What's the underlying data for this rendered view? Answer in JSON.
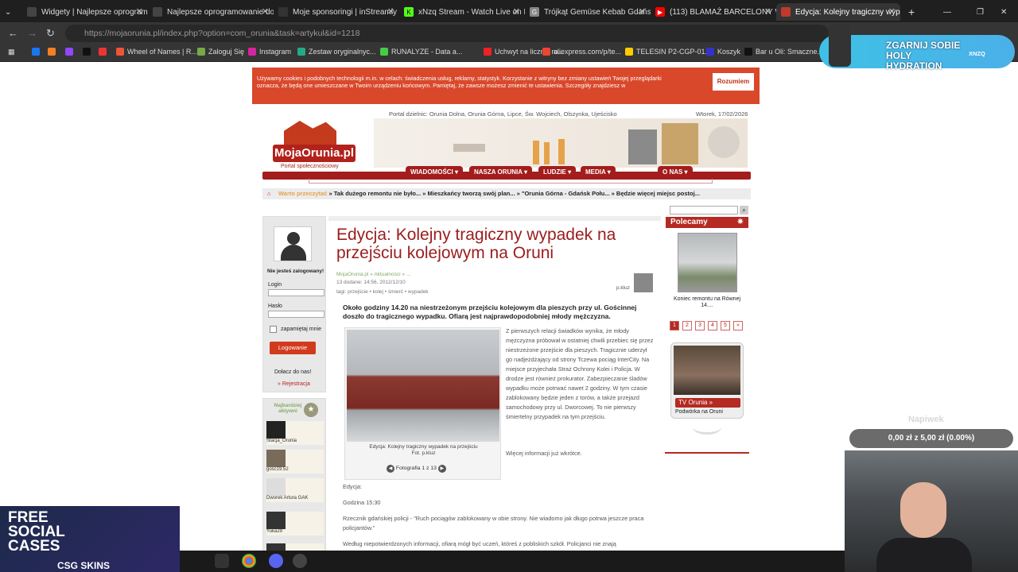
{
  "browser": {
    "tabs": [
      {
        "label": "Widgety | Najlepsze oprogramo",
        "color": "#444"
      },
      {
        "label": "Najlepsze oprogramowanie do",
        "color": "#444"
      },
      {
        "label": "Moje sponsoringi | inStreamly",
        "color": "#333"
      },
      {
        "label": "xNzq Stream - Watch Live on K",
        "color": "#53fc18"
      },
      {
        "label": "Trójkąt Gemüse Kebab Gdańsk",
        "color": "#888"
      },
      {
        "label": "(113) BLAMAŻ BARCELONY W",
        "color": "#ff0000"
      },
      {
        "label": "Edycja: Kolejny tragiczny wypa",
        "color": "#c0392b"
      }
    ],
    "url": "https://mojaorunia.pl/index.php?option=com_orunia&task=artykul&id=1218",
    "bookmarks": [
      {
        "label": "",
        "color": "#1877f2"
      },
      {
        "label": "",
        "color": "#f48024"
      },
      {
        "label": "",
        "color": "#9146ff"
      },
      {
        "label": "",
        "color": "#111"
      },
      {
        "label": "",
        "color": "#e33"
      },
      {
        "label": "Wheel of Names | R...",
        "color": "#e53"
      },
      {
        "label": "Zaloguj Się",
        "color": "#7a4"
      },
      {
        "label": "Instagram",
        "color": "#d6249f"
      },
      {
        "label": "Zestaw oryginalnyc...",
        "color": "#2a8"
      },
      {
        "label": "RUNALYZE - Data a...",
        "color": "#4c4"
      },
      {
        "label": "Uchwyt na licznik ro...",
        "color": "#e22"
      },
      {
        "label": "aliexpress.com/p/te...",
        "color": "#e43"
      },
      {
        "label": "TELESIN P2-CGP-01...",
        "color": "#fc0"
      },
      {
        "label": "Koszyk",
        "color": "#33c"
      },
      {
        "label": "Bar u Oli: Smaczne...",
        "color": "#111"
      }
    ]
  },
  "cookie": {
    "text": "Używamy cookies i podobnych technologii m.in. w celach: świadczenia usług, reklamy, statystyk. Korzystanie z witryny bez zmiany ustawień Twojej przeglądarki oznacza, że będą one umieszczane w Twoim urządzeniu końcowym. Pamiętaj, że zawsze możesz zmienić te ustawienia. Szczegóły znajdziesz w",
    "button": "Rozumiem"
  },
  "header": {
    "portal": "Portal dzielnic: Orunia Dolna, Orunia Górna, Lipce, Św. Wojciech, Olszynka, Ujeścisko",
    "date": "Wtorek, 17/02/2026",
    "logo": "MojaOrunia.pl",
    "logo_sub": "Portal społecznościowy",
    "menu": [
      "WIADOMOŚCI ▾",
      "NASZA ORUNIA ▾",
      "LUDZIE ▾",
      "MEDIA ▾",
      "O NAS ▾"
    ],
    "news_prefix": "Warto przeczytać",
    "news": "» Tak dużego remontu nie było... » Mieszkańcy tworzą swój plan... » \"Orunia Górna - Gdańsk Połu... » Będzie więcej miejsc postoj..."
  },
  "login": {
    "status": "Nie jesteś zalogowany!",
    "login_label": "Login",
    "password_label": "Hasło",
    "remember": "zapamiętaj mnie",
    "button": "Logowanie",
    "join": "Dołacz do nas!",
    "register": "» Rejestracja"
  },
  "active": {
    "title": "Najbardziej aktywni",
    "users": [
      "Stacja_Orunia",
      "gosc19.52",
      "Dworek Artura GAK",
      "Yuka29",
      ""
    ]
  },
  "article": {
    "title": "Edycja: Kolejny tragiczny wypadek na przejściu kolejowym na Oruni",
    "crumb": "MojaOrunia.pl » Aktualności » ...",
    "added": "13 dodane: 14:56, 2012/12/10",
    "tags": "tagi: przejście • kolej • śmierć • wypadek",
    "author": "p.kluz",
    "lead": "Około godziny 14.20 na niestrzeżonym przejściu kolejowym dla pieszych przy ul. Gościnnej doszło do tragicznego wypadku. Ofiarą jest najprawdopodobniej młody mężczyzna.",
    "photo_caption": "Edycja: Kolejny tragiczny wypadek na przejściu",
    "photo_credit": "Fot. p.kluz",
    "photo_pager": "Fotografia 1 z 13",
    "body": "Z pierwszych relacji świadków wynika, że młody mężczyzna próbował w ostatniej chwili przebiec się przez niestrzeżone przejście dla pieszych. Tragicznie uderzył go nadjeżdżający od strony Tczewa pociąg InterCity. Na miejsce przyjechała Straż Ochrony Kolei i Policja. W drodze jest również prokurator. Zabezpieczanie śladów wypadku może potrwać nawet 2 godziny. W tym czasie zablokowany będzie jeden z torów, a także przejazd samochodowy przy ul. Dworcowej. To nie pierwszy śmiertelny przypadek na tym przejściu.",
    "more": "Więcej informacji już wkrótce.",
    "edycja": "Edycja:",
    "time": "Godzina 15:30",
    "quote": "Rzecznik gdańskiej policji - \"Ruch pociągów zablokowany w obie strony. Nie wiadomo jak długo potrwa jeszcze praca policjantów.\"",
    "last": "Według niepotwierdzonych informacji, ofiarą mógł być uczeń, któreś z pobliskich szkół. Policjanci nie znają"
  },
  "sidebar": {
    "polecamy": "Polecamy",
    "rec_title": "Koniec remontu na Równej 14....",
    "pages": [
      "1",
      "2",
      "3",
      "4",
      "5",
      "»"
    ],
    "tv_label": "TV Orunia »",
    "tv_sub": "Podwórka na Oruni"
  },
  "overlay": {
    "promo_text": "ZGARNIJ SOBIE HOLY HYDRATION",
    "promo_code": "XNZQ",
    "tip_title": "Napiwek",
    "tip_value": "0,00 zł z 5,00 zł (0.00%)",
    "csg_text": "FREE SOCIAL CASES",
    "csg_brand": "CSG SKINS"
  }
}
